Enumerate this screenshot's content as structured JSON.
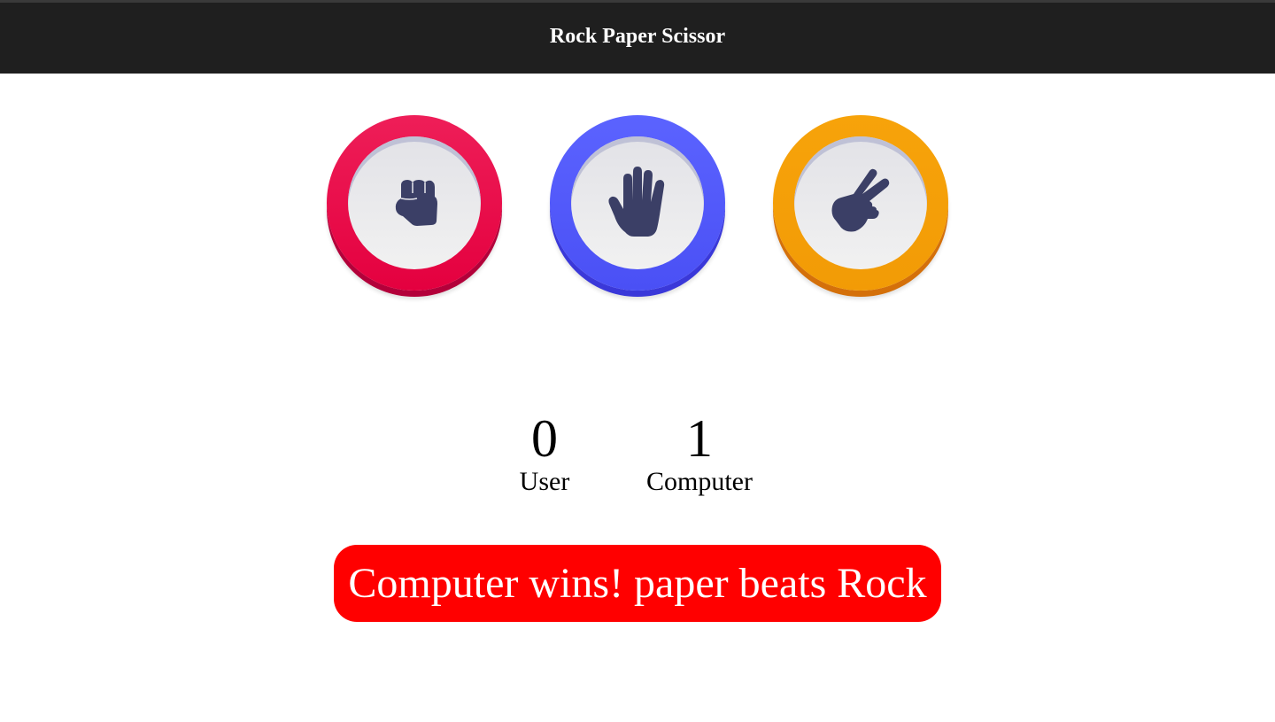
{
  "header": {
    "title": "Rock Paper Scissor"
  },
  "choices": [
    {
      "id": "rock",
      "icon": "fist-icon",
      "color": "#e4003f"
    },
    {
      "id": "paper",
      "icon": "open-hand-icon",
      "color": "#4a50f5"
    },
    {
      "id": "scissors",
      "icon": "peace-hand-icon",
      "color": "#f29b06"
    }
  ],
  "scoreboard": {
    "user": {
      "value": "0",
      "label": "User"
    },
    "computer": {
      "value": "1",
      "label": "Computer"
    }
  },
  "result": {
    "message": "Computer wins! paper beats Rock",
    "color": "#ff0000"
  }
}
